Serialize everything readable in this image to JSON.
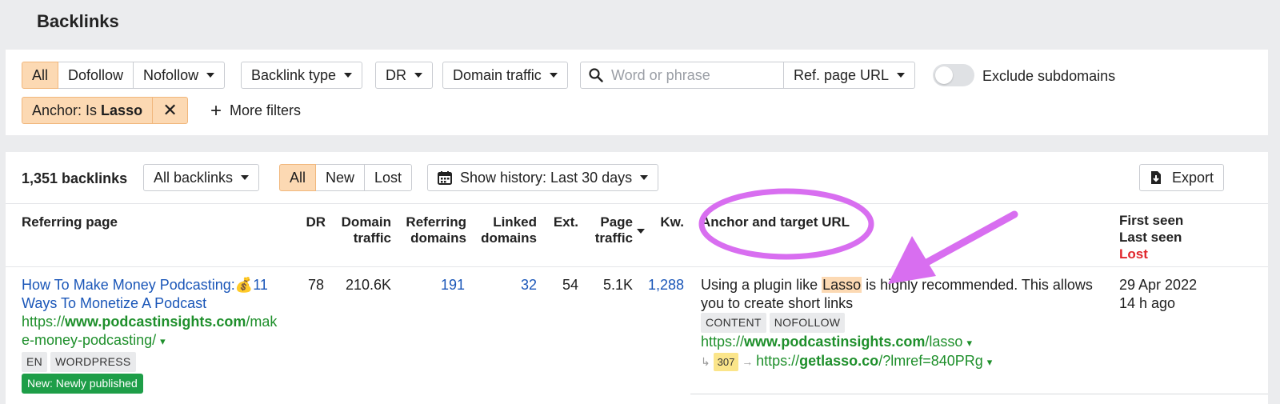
{
  "page": {
    "title": "Backlinks"
  },
  "filters": {
    "link_types": [
      "All",
      "Dofollow",
      "Nofollow"
    ],
    "backlink_type": "Backlink type",
    "dr": "DR",
    "domain_traffic": "Domain traffic",
    "search_placeholder": "Word or phrase",
    "ref_page_url": "Ref. page URL",
    "exclude_subdomains": "Exclude subdomains",
    "anchor_chip_prefix": "Anchor: Is ",
    "anchor_chip_value": "Lasso",
    "more_filters": "More filters"
  },
  "results": {
    "count": "1,351 backlinks",
    "scope": "All backlinks",
    "status_tabs": [
      "All",
      "New",
      "Lost"
    ],
    "history": "Show history: Last 30 days",
    "export": "Export"
  },
  "columns": {
    "referring_page": "Referring page",
    "dr": "DR",
    "domain_traffic": [
      "Domain",
      "traffic"
    ],
    "referring_domains": [
      "Referring",
      "domains"
    ],
    "linked_domains": [
      "Linked",
      "domains"
    ],
    "ext": "Ext.",
    "page_traffic": [
      "Page",
      "traffic"
    ],
    "kw": "Kw.",
    "anchor": "Anchor and target URL",
    "first_seen": "First seen",
    "last_seen": "Last seen",
    "lost": "Lost"
  },
  "row": {
    "title_line1": "How To Make Money Podcasting:💰11",
    "title_line2": "Ways To Monetize A Podcast",
    "url_prefix": "https://",
    "url_domain": "www.podcastinsights.com",
    "url_path_1": "/mak",
    "url_path_2": "e-money-podcasting/",
    "tags": [
      "EN",
      "WORDPRESS"
    ],
    "new_badge": "New: Newly published",
    "dr": "78",
    "domain_traffic": "210.6K",
    "referring_domains": "191",
    "linked_domains": "32",
    "ext": "54",
    "page_traffic": "5.1K",
    "kw": "1,288",
    "anchor_before": "Using a plugin like ",
    "anchor_text": "Lasso",
    "anchor_after": " is highly recommended. This allows",
    "anchor_line2": "you to create short links",
    "link_tags": [
      "CONTENT",
      "NOFOLLOW"
    ],
    "target_prefix": "https://",
    "target_domain": "www.podcastinsights.com",
    "target_path": "/lasso",
    "redirect_code": "307",
    "redirect_prefix": "https://",
    "redirect_domain": "getlasso.co",
    "redirect_path": "/?lmref=840PRg",
    "first_seen": "29 Apr 2022",
    "last_seen": "14 h ago"
  },
  "colors": {
    "accent_bg": "#fcd9b3",
    "link_blue": "#1a56b8",
    "url_green": "#1e8f2b",
    "lost_red": "#e0262b",
    "annotation": "#d86ef0"
  }
}
